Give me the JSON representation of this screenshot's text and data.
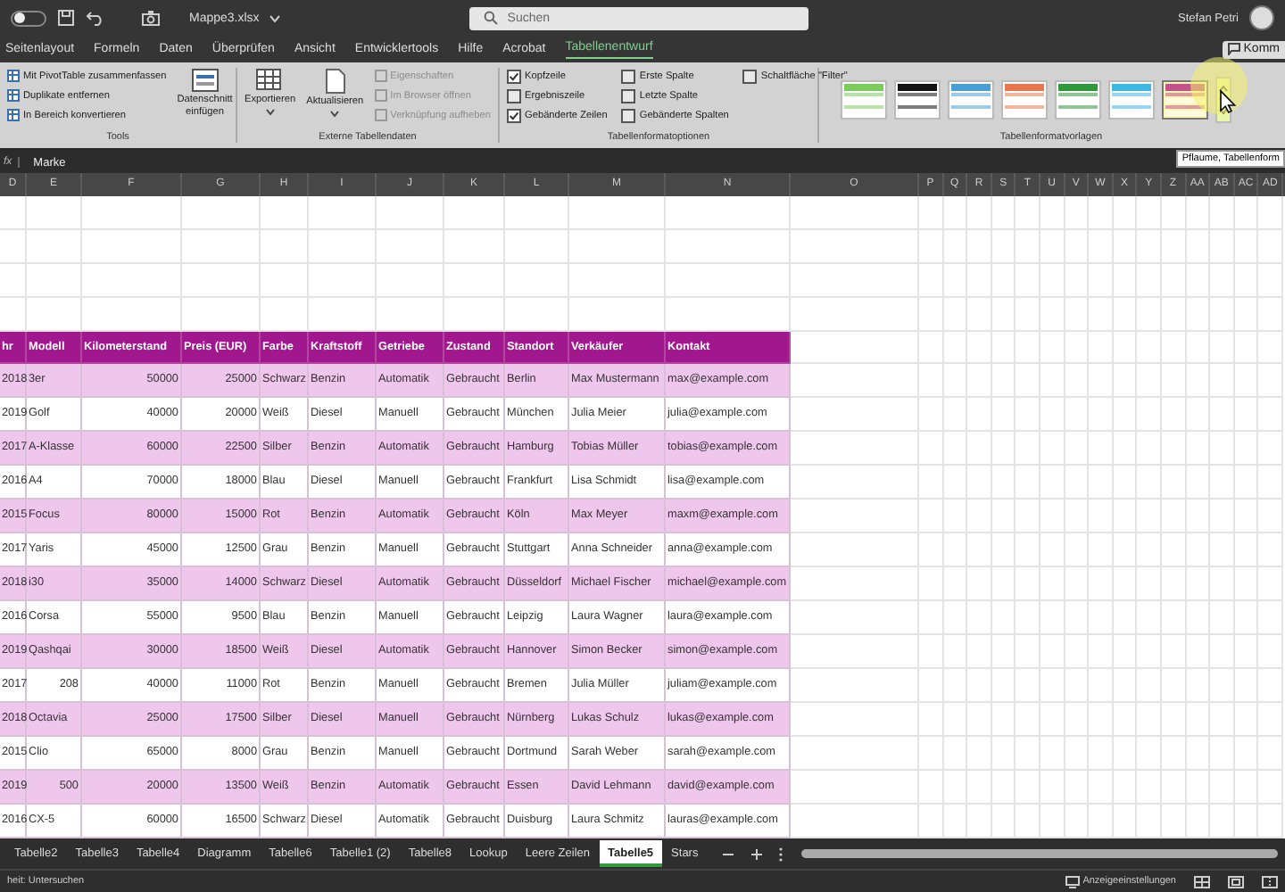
{
  "title_bar": {
    "autosave_on": false,
    "file_name": "Mappe3.xlsx",
    "search": {
      "placeholder": "Suchen"
    },
    "user_name": "Stefan Petri"
  },
  "ribbon_tabs": [
    {
      "label": "Seitenlayout",
      "selected": false
    },
    {
      "label": "Formeln",
      "selected": false
    },
    {
      "label": "Daten",
      "selected": false
    },
    {
      "label": "Überprüfen",
      "selected": false
    },
    {
      "label": "Ansicht",
      "selected": false
    },
    {
      "label": "Entwicklertools",
      "selected": false
    },
    {
      "label": "Hilfe",
      "selected": false
    },
    {
      "label": "Acrobat",
      "selected": false
    },
    {
      "label": "Tabellenentwurf",
      "selected": true
    }
  ],
  "comment_button": "Komm",
  "ribbon": {
    "tools": {
      "label": "Tools",
      "items": [
        "Mit PivotTable zusammenfassen",
        "Duplikate entfernen",
        "In Bereich konvertieren"
      ],
      "slicer_button": "Datenschnitt einfügen"
    },
    "external_data": {
      "label": "Externe Tabellendaten",
      "buttons": [
        "Exportieren",
        "Aktualisieren"
      ],
      "items": [
        {
          "label": "Eigenschaften",
          "disabled": true
        },
        {
          "label": "Im Browser öffnen",
          "disabled": true
        },
        {
          "label": "Verknüpfung aufheben",
          "disabled": true
        }
      ]
    },
    "style_options": {
      "label": "Tabellenformatoptionen",
      "options": [
        {
          "label": "Kopfzeile",
          "checked": true
        },
        {
          "label": "Ergebniszeile",
          "checked": false
        },
        {
          "label": "Gebänderte Zeilen",
          "checked": true
        },
        {
          "label": "Erste Spalte",
          "checked": false
        },
        {
          "label": "Letzte Spalte",
          "checked": false
        },
        {
          "label": "Gebänderte Spalten",
          "checked": false
        },
        {
          "label": "Schaltfläche \"Filter\"",
          "checked": false
        }
      ]
    },
    "styles": {
      "label": "Tabellenformatvorlagen",
      "swatches": [
        {
          "color": "#7ccc5c",
          "selected": false
        },
        {
          "color": "#111111",
          "selected": false
        },
        {
          "color": "#4a9fd4",
          "selected": false
        },
        {
          "color": "#e8764c",
          "selected": false
        },
        {
          "color": "#2f9a3c",
          "selected": false
        },
        {
          "color": "#3cb8e2",
          "selected": false
        },
        {
          "color": "#c2518c",
          "selected": true
        }
      ]
    }
  },
  "tooltip": "Pflaume, Tabellenform",
  "formula_bar": {
    "fx": "fx",
    "value": "Marke"
  },
  "column_headers": [
    "D",
    "E",
    "F",
    "G",
    "H",
    "I",
    "J",
    "K",
    "L",
    "M",
    "N",
    "O",
    "P",
    "Q",
    "R",
    "S",
    "T",
    "U",
    "V",
    "W",
    "X",
    "Y",
    "Z",
    "AA",
    "AB",
    "AC",
    "AD"
  ],
  "table": {
    "columns": [
      "hr",
      "Modell",
      "Kilometerstand",
      "Preis (EUR)",
      "Farbe",
      "Kraftstoff",
      "Getriebe",
      "Zustand",
      "Standort",
      "Verkäufer",
      "Kontakt"
    ],
    "rows": [
      {
        "numeric_model": false,
        "cells": [
          "2018",
          "3er",
          "50000",
          "25000",
          "Schwarz",
          "Benzin",
          "Automatik",
          "Gebraucht",
          "Berlin",
          "Max Mustermann",
          "max@example.com"
        ]
      },
      {
        "numeric_model": false,
        "cells": [
          "2019",
          "Golf",
          "40000",
          "20000",
          "Weiß",
          "Diesel",
          "Manuell",
          "Gebraucht",
          "München",
          "Julia Meier",
          "julia@example.com"
        ]
      },
      {
        "numeric_model": false,
        "cells": [
          "2017",
          "A-Klasse",
          "60000",
          "22500",
          "Silber",
          "Benzin",
          "Automatik",
          "Gebraucht",
          "Hamburg",
          "Tobias Müller",
          "tobias@example.com"
        ]
      },
      {
        "numeric_model": false,
        "cells": [
          "2016",
          "A4",
          "70000",
          "18000",
          "Blau",
          "Diesel",
          "Manuell",
          "Gebraucht",
          "Frankfurt",
          "Lisa Schmidt",
          "lisa@example.com"
        ]
      },
      {
        "numeric_model": false,
        "cells": [
          "2015",
          "Focus",
          "80000",
          "15000",
          "Rot",
          "Benzin",
          "Automatik",
          "Gebraucht",
          "Köln",
          "Max Meyer",
          "maxm@example.com"
        ]
      },
      {
        "numeric_model": false,
        "cells": [
          "2017",
          "Yaris",
          "45000",
          "12500",
          "Grau",
          "Benzin",
          "Manuell",
          "Gebraucht",
          "Stuttgart",
          "Anna Schneider",
          "anna@example.com"
        ]
      },
      {
        "numeric_model": false,
        "cells": [
          "2018",
          "i30",
          "35000",
          "14000",
          "Schwarz",
          "Diesel",
          "Automatik",
          "Gebraucht",
          "Düsseldorf",
          "Michael Fischer",
          "michael@example.com"
        ]
      },
      {
        "numeric_model": false,
        "cells": [
          "2016",
          "Corsa",
          "55000",
          "9500",
          "Blau",
          "Benzin",
          "Manuell",
          "Gebraucht",
          "Leipzig",
          "Laura Wagner",
          "laura@example.com"
        ]
      },
      {
        "numeric_model": false,
        "cells": [
          "2019",
          "Qashqai",
          "30000",
          "18500",
          "Weiß",
          "Diesel",
          "Automatik",
          "Gebraucht",
          "Hannover",
          "Simon Becker",
          "simon@example.com"
        ]
      },
      {
        "numeric_model": true,
        "cells": [
          "2017",
          "208",
          "40000",
          "11000",
          "Rot",
          "Benzin",
          "Manuell",
          "Gebraucht",
          "Bremen",
          "Julia Müller",
          "juliam@example.com"
        ]
      },
      {
        "numeric_model": false,
        "cells": [
          "2018",
          "Octavia",
          "25000",
          "17500",
          "Silber",
          "Diesel",
          "Manuell",
          "Gebraucht",
          "Nürnberg",
          "Lukas Schulz",
          "lukas@example.com"
        ]
      },
      {
        "numeric_model": false,
        "cells": [
          "2015",
          "Clio",
          "65000",
          "8000",
          "Grau",
          "Benzin",
          "Manuell",
          "Gebraucht",
          "Dortmund",
          "Sarah Weber",
          "sarah@example.com"
        ]
      },
      {
        "numeric_model": true,
        "cells": [
          "2019",
          "500",
          "20000",
          "13500",
          "Weiß",
          "Benzin",
          "Automatik",
          "Gebraucht",
          "Essen",
          "David Lehmann",
          "david@example.com"
        ]
      },
      {
        "numeric_model": false,
        "cells": [
          "2016",
          "CX-5",
          "60000",
          "16500",
          "Schwarz",
          "Diesel",
          "Automatik",
          "Gebraucht",
          "Duisburg",
          "Laura Schmitz",
          "lauras@example.com"
        ]
      }
    ]
  },
  "sheet_tabs": [
    {
      "label": "Tabelle2",
      "selected": false
    },
    {
      "label": "Tabelle3",
      "selected": false
    },
    {
      "label": "Tabelle4",
      "selected": false
    },
    {
      "label": "Diagramm",
      "selected": false
    },
    {
      "label": "Tabelle6",
      "selected": false
    },
    {
      "label": "Tabelle1 (2)",
      "selected": false
    },
    {
      "label": "Tabelle8",
      "selected": false
    },
    {
      "label": "Lookup",
      "selected": false
    },
    {
      "label": "Leere Zeilen",
      "selected": false
    },
    {
      "label": "Tabelle5",
      "selected": true
    },
    {
      "label": "Stars",
      "selected": false
    }
  ],
  "status_bar": {
    "text": "heit: Untersuchen",
    "display_settings": "Anzeigeeinstellungen"
  }
}
